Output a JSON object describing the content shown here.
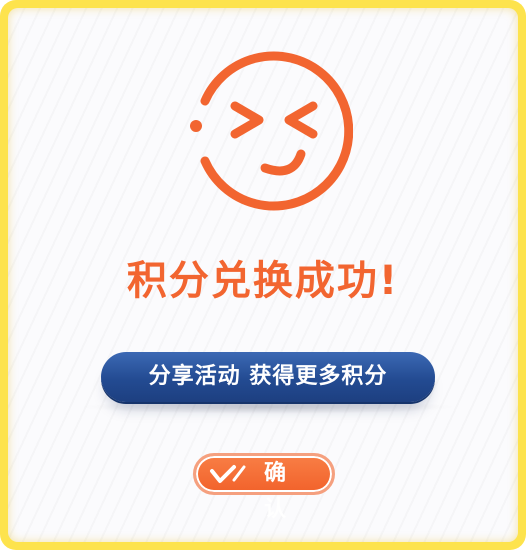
{
  "dialog": {
    "title": "积分兑换成功!",
    "share_button_label": "分享活动 获得更多积分",
    "confirm_button_label": "确 认"
  },
  "icons": {
    "face": "wink-smile-icon",
    "confirm": "check-icon"
  },
  "colors": {
    "accent_orange": "#f26530",
    "share_button_blue": "#234b92",
    "frame_yellow": "#fde34d"
  }
}
